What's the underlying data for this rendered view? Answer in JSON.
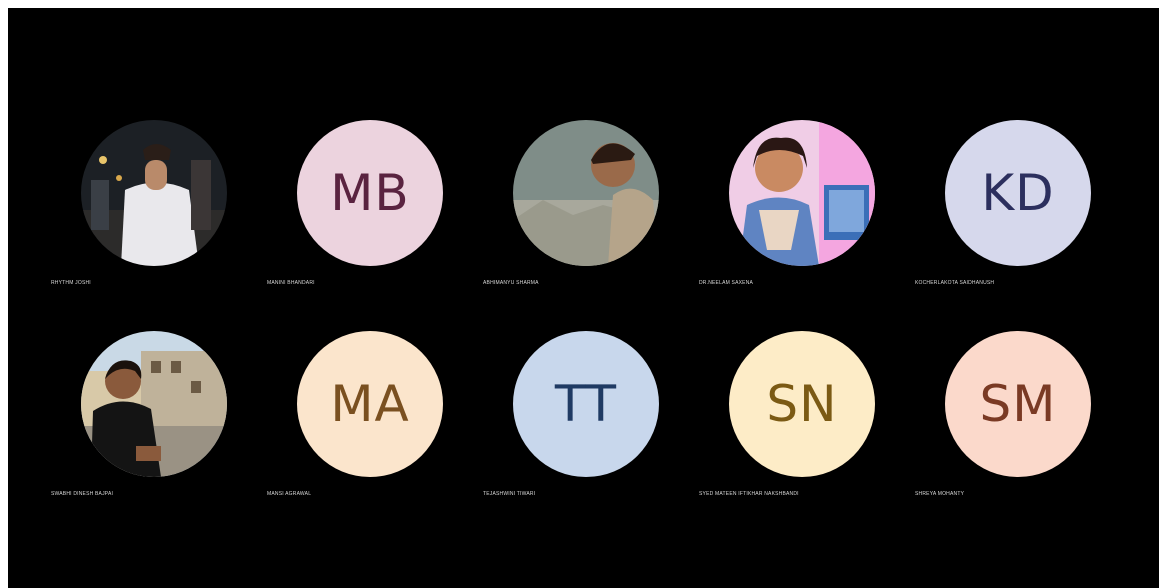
{
  "participants": [
    {
      "name": "RHYTHM JOSHI",
      "type": "photo",
      "photo_icon": "user-photo-icon"
    },
    {
      "name": "MANINI BHANDARI",
      "type": "initials",
      "initials": "MB",
      "bg": "#ecd3de",
      "fg": "#5a2340"
    },
    {
      "name": "ABHIMANYU SHARMA",
      "type": "photo",
      "photo_icon": "user-photo-icon"
    },
    {
      "name": "Dr.Neelam Saxena",
      "type": "photo",
      "photo_icon": "user-photo-icon"
    },
    {
      "name": "KOCHERLAKOTA SAIDHANUSH",
      "type": "initials",
      "initials": "KD",
      "bg": "#d6d8ec",
      "fg": "#2c2f5e"
    },
    {
      "name": "SWABHI DINESH BAJPAI",
      "type": "photo",
      "photo_icon": "user-photo-icon"
    },
    {
      "name": "MANSI AGRAWAL",
      "type": "initials",
      "initials": "MA",
      "bg": "#fbe5cc",
      "fg": "#7a5020"
    },
    {
      "name": "TEJASHWINI TIWARI",
      "type": "initials",
      "initials": "TT",
      "bg": "#c8d7ec",
      "fg": "#1f3a63"
    },
    {
      "name": "SYED MATEEN IFTIKHAR NAKSHBANDI",
      "type": "initials",
      "initials": "SN",
      "bg": "#fdecc7",
      "fg": "#7b5a14"
    },
    {
      "name": "SHREYA MOHANTY",
      "type": "initials",
      "initials": "SM",
      "bg": "#fbd9cb",
      "fg": "#7a3a24"
    }
  ]
}
